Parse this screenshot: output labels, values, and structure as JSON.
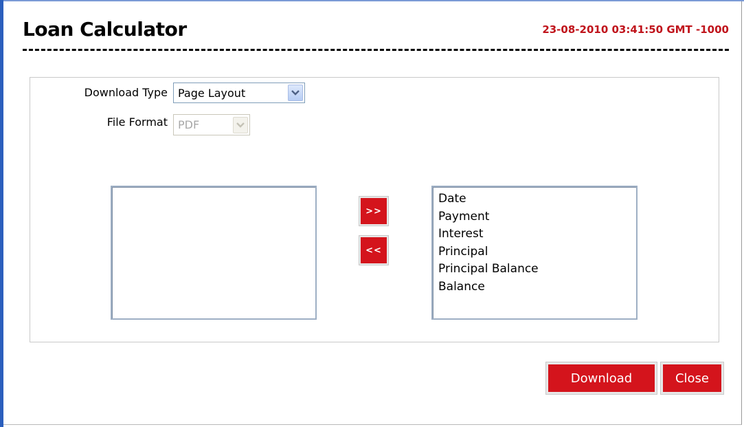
{
  "header": {
    "title": "Loan Calculator",
    "timestamp": "23-08-2010 03:41:50 GMT -1000"
  },
  "form": {
    "download_type": {
      "label": "Download Type",
      "value": "Page Layout"
    },
    "file_format": {
      "label": "File Format",
      "value": "PDF",
      "disabled": true
    }
  },
  "columns": {
    "available": [],
    "selected": [
      "Date",
      "Payment",
      "Interest",
      "Principal",
      "Principal Balance",
      "Balance"
    ],
    "add_label": ">>",
    "remove_label": "<<"
  },
  "actions": {
    "download_label": "Download",
    "close_label": "Close"
  },
  "colors": {
    "accent_red": "#d4141c",
    "timestamp_red": "#c0141c"
  }
}
